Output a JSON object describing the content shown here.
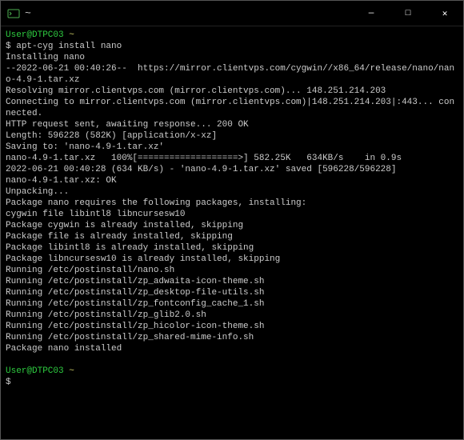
{
  "titlebar": {
    "title": "~",
    "min": "—",
    "max": "□",
    "close": "✕"
  },
  "prompt": {
    "user_host": "User@DTPC03",
    "path": "~",
    "symbol": "$"
  },
  "cmd": "apt-cyg install nano",
  "out": {
    "l1": "Installing nano",
    "l2": "--2022-06-21 00:40:26--  https://mirror.clientvps.com/cygwin//x86_64/release/nano/nano-4.9-1.tar.xz",
    "l3": "Resolving mirror.clientvps.com (mirror.clientvps.com)... 148.251.214.203",
    "l4": "Connecting to mirror.clientvps.com (mirror.clientvps.com)|148.251.214.203|:443... connected.",
    "l5": "HTTP request sent, awaiting response... 200 OK",
    "l6": "Length: 596228 (582K) [application/x-xz]",
    "l7": "Saving to: 'nano-4.9-1.tar.xz'",
    "l8": "",
    "l9": "nano-4.9-1.tar.xz   100%[===================>] 582.25K   634KB/s    in 0.9s",
    "l10": "",
    "l11": "2022-06-21 00:40:28 (634 KB/s) - 'nano-4.9-1.tar.xz' saved [596228/596228]",
    "l12": "",
    "l13": "nano-4.9-1.tar.xz: OK",
    "l14": "Unpacking...",
    "l15": "Package nano requires the following packages, installing:",
    "l16": "cygwin file libintl8 libncursesw10",
    "l17": "Package cygwin is already installed, skipping",
    "l18": "Package file is already installed, skipping",
    "l19": "Package libintl8 is already installed, skipping",
    "l20": "Package libncursesw10 is already installed, skipping",
    "l21": "Running /etc/postinstall/nano.sh",
    "l22": "Running /etc/postinstall/zp_adwaita-icon-theme.sh",
    "l23": "Running /etc/postinstall/zp_desktop-file-utils.sh",
    "l24": "Running /etc/postinstall/zp_fontconfig_cache_1.sh",
    "l25": "Running /etc/postinstall/zp_glib2.0.sh",
    "l26": "Running /etc/postinstall/zp_hicolor-icon-theme.sh",
    "l27": "Running /etc/postinstall/zp_shared-mime-info.sh",
    "l28": "Package nano installed"
  }
}
